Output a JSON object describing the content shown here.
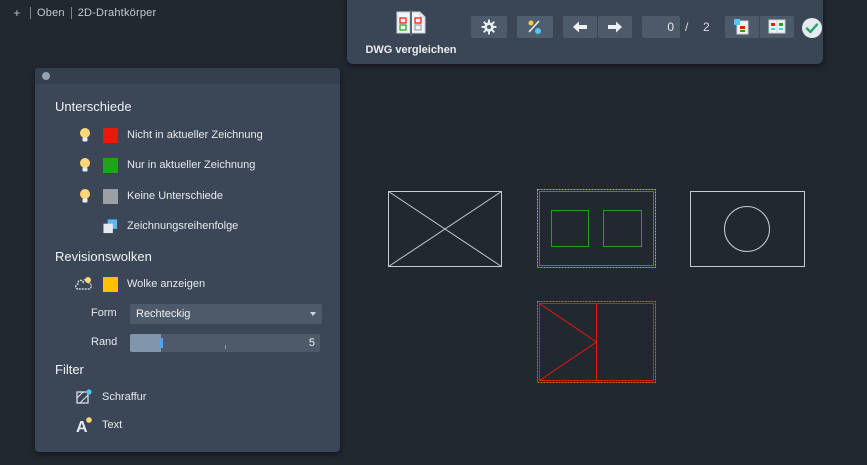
{
  "viewport": {
    "plus": "+",
    "view": "Oben",
    "style": "2D-Drahtkörper"
  },
  "toolbar": {
    "compare_label": "DWG vergleichen",
    "current_index": "0",
    "separator": "/",
    "total": "2",
    "icons": [
      "settings-icon",
      "percent-toggle-icon",
      "arrow-left-icon",
      "arrow-right-icon",
      "zoom-fit-icon",
      "snapshot-icon",
      "checkmark-icon"
    ]
  },
  "panel": {
    "differences_title": "Unterschiede",
    "differences": [
      {
        "label": "Nicht in aktueller Zeichnung",
        "color": "#e8190b"
      },
      {
        "label": "Nur in aktueller Zeichnung",
        "color": "#21a21a"
      },
      {
        "label": "Keine Unterschiede",
        "color": "#9aa0a6"
      },
      {
        "label": "Zeichnungsreihenfolge"
      }
    ],
    "clouds_title": "Revisionswolken",
    "show_cloud": {
      "label": "Wolke anzeigen",
      "color": "#ffc000"
    },
    "form_label": "Form",
    "form_value": "Rechteckig",
    "margin_label": "Rand",
    "margin_value": "5",
    "filter_title": "Filter",
    "filters": [
      {
        "label": "Schraffur",
        "icon": "hatch-icon"
      },
      {
        "label": "Text",
        "icon": "text-icon"
      }
    ]
  },
  "colors": {
    "background": "#212830",
    "panel": "#3b4757",
    "red": "#e8190b",
    "green": "#21a21a",
    "bulb": "#ffd778"
  }
}
